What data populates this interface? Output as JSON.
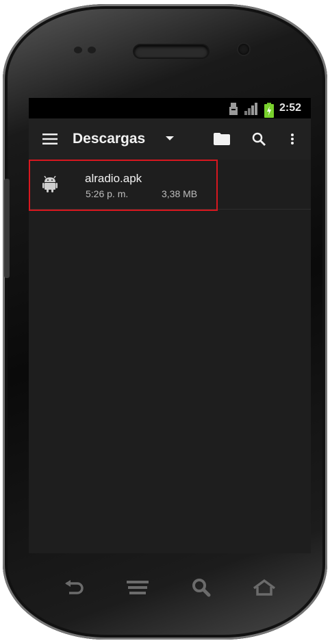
{
  "status_bar": {
    "time": "2:52",
    "icons": [
      "usb-debug-icon",
      "signal-icon",
      "battery-charging-icon"
    ]
  },
  "toolbar": {
    "title": "Descargas",
    "icons": [
      "menu-icon",
      "dropdown-arrow-icon",
      "folder-icon",
      "search-icon",
      "overflow-menu-icon"
    ]
  },
  "files": [
    {
      "name": "alradio.apk",
      "time": "5:26 p. m.",
      "size": "3,38 MB",
      "icon": "android-icon"
    }
  ],
  "nav_buttons": [
    "back-icon",
    "menu-icon",
    "search-icon",
    "home-icon"
  ],
  "colors": {
    "screen_bg": "#1e1e1e",
    "toolbar_bg": "#212121",
    "highlight": "#d9171f"
  }
}
